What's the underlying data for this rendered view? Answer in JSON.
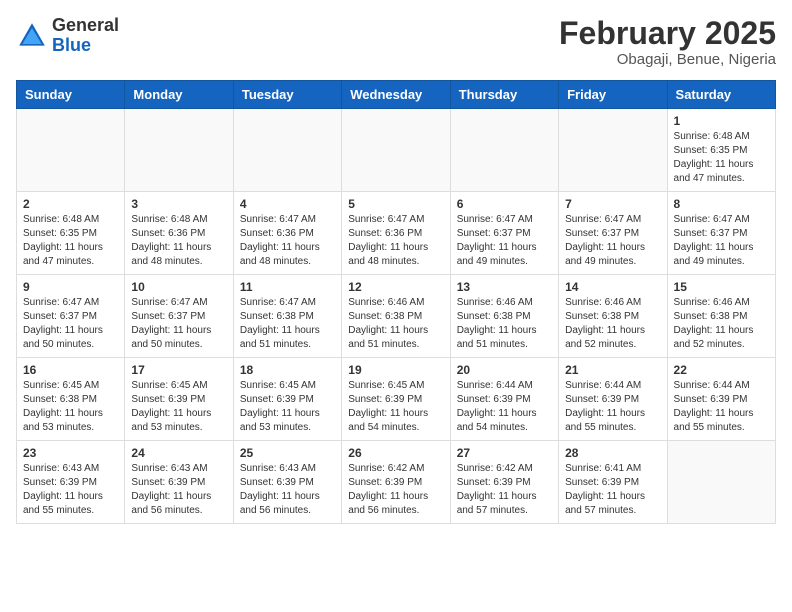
{
  "header": {
    "logo_general": "General",
    "logo_blue": "Blue",
    "month_title": "February 2025",
    "location": "Obagaji, Benue, Nigeria"
  },
  "days_of_week": [
    "Sunday",
    "Monday",
    "Tuesday",
    "Wednesday",
    "Thursday",
    "Friday",
    "Saturday"
  ],
  "weeks": [
    [
      {
        "day": "",
        "info": ""
      },
      {
        "day": "",
        "info": ""
      },
      {
        "day": "",
        "info": ""
      },
      {
        "day": "",
        "info": ""
      },
      {
        "day": "",
        "info": ""
      },
      {
        "day": "",
        "info": ""
      },
      {
        "day": "1",
        "info": "Sunrise: 6:48 AM\nSunset: 6:35 PM\nDaylight: 11 hours and 47 minutes."
      }
    ],
    [
      {
        "day": "2",
        "info": "Sunrise: 6:48 AM\nSunset: 6:35 PM\nDaylight: 11 hours and 47 minutes."
      },
      {
        "day": "3",
        "info": "Sunrise: 6:48 AM\nSunset: 6:36 PM\nDaylight: 11 hours and 48 minutes."
      },
      {
        "day": "4",
        "info": "Sunrise: 6:47 AM\nSunset: 6:36 PM\nDaylight: 11 hours and 48 minutes."
      },
      {
        "day": "5",
        "info": "Sunrise: 6:47 AM\nSunset: 6:36 PM\nDaylight: 11 hours and 48 minutes."
      },
      {
        "day": "6",
        "info": "Sunrise: 6:47 AM\nSunset: 6:37 PM\nDaylight: 11 hours and 49 minutes."
      },
      {
        "day": "7",
        "info": "Sunrise: 6:47 AM\nSunset: 6:37 PM\nDaylight: 11 hours and 49 minutes."
      },
      {
        "day": "8",
        "info": "Sunrise: 6:47 AM\nSunset: 6:37 PM\nDaylight: 11 hours and 49 minutes."
      }
    ],
    [
      {
        "day": "9",
        "info": "Sunrise: 6:47 AM\nSunset: 6:37 PM\nDaylight: 11 hours and 50 minutes."
      },
      {
        "day": "10",
        "info": "Sunrise: 6:47 AM\nSunset: 6:37 PM\nDaylight: 11 hours and 50 minutes."
      },
      {
        "day": "11",
        "info": "Sunrise: 6:47 AM\nSunset: 6:38 PM\nDaylight: 11 hours and 51 minutes."
      },
      {
        "day": "12",
        "info": "Sunrise: 6:46 AM\nSunset: 6:38 PM\nDaylight: 11 hours and 51 minutes."
      },
      {
        "day": "13",
        "info": "Sunrise: 6:46 AM\nSunset: 6:38 PM\nDaylight: 11 hours and 51 minutes."
      },
      {
        "day": "14",
        "info": "Sunrise: 6:46 AM\nSunset: 6:38 PM\nDaylight: 11 hours and 52 minutes."
      },
      {
        "day": "15",
        "info": "Sunrise: 6:46 AM\nSunset: 6:38 PM\nDaylight: 11 hours and 52 minutes."
      }
    ],
    [
      {
        "day": "16",
        "info": "Sunrise: 6:45 AM\nSunset: 6:38 PM\nDaylight: 11 hours and 53 minutes."
      },
      {
        "day": "17",
        "info": "Sunrise: 6:45 AM\nSunset: 6:39 PM\nDaylight: 11 hours and 53 minutes."
      },
      {
        "day": "18",
        "info": "Sunrise: 6:45 AM\nSunset: 6:39 PM\nDaylight: 11 hours and 53 minutes."
      },
      {
        "day": "19",
        "info": "Sunrise: 6:45 AM\nSunset: 6:39 PM\nDaylight: 11 hours and 54 minutes."
      },
      {
        "day": "20",
        "info": "Sunrise: 6:44 AM\nSunset: 6:39 PM\nDaylight: 11 hours and 54 minutes."
      },
      {
        "day": "21",
        "info": "Sunrise: 6:44 AM\nSunset: 6:39 PM\nDaylight: 11 hours and 55 minutes."
      },
      {
        "day": "22",
        "info": "Sunrise: 6:44 AM\nSunset: 6:39 PM\nDaylight: 11 hours and 55 minutes."
      }
    ],
    [
      {
        "day": "23",
        "info": "Sunrise: 6:43 AM\nSunset: 6:39 PM\nDaylight: 11 hours and 55 minutes."
      },
      {
        "day": "24",
        "info": "Sunrise: 6:43 AM\nSunset: 6:39 PM\nDaylight: 11 hours and 56 minutes."
      },
      {
        "day": "25",
        "info": "Sunrise: 6:43 AM\nSunset: 6:39 PM\nDaylight: 11 hours and 56 minutes."
      },
      {
        "day": "26",
        "info": "Sunrise: 6:42 AM\nSunset: 6:39 PM\nDaylight: 11 hours and 56 minutes."
      },
      {
        "day": "27",
        "info": "Sunrise: 6:42 AM\nSunset: 6:39 PM\nDaylight: 11 hours and 57 minutes."
      },
      {
        "day": "28",
        "info": "Sunrise: 6:41 AM\nSunset: 6:39 PM\nDaylight: 11 hours and 57 minutes."
      },
      {
        "day": "",
        "info": ""
      }
    ]
  ]
}
